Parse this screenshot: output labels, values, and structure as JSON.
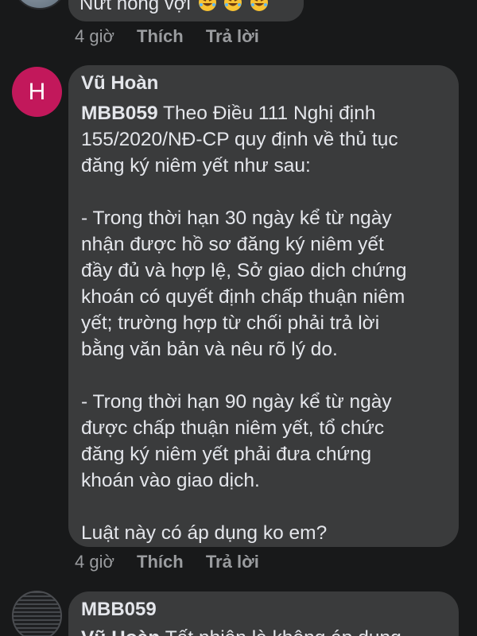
{
  "top_comment": {
    "text": "Nứt hông vợi",
    "emoji": [
      "rofl-emoji",
      "rofl-emoji",
      "rofl-emoji"
    ],
    "time": "4 giờ",
    "like_label": "Thích",
    "reply_label": "Trả lời"
  },
  "main_comment": {
    "avatar_letter": "H",
    "avatar_color": "#c2185b",
    "author": "Vũ Hoàn",
    "mention": "MBB059",
    "lines": [
      " Theo Điều 111 Nghị định",
      "155/2020/NĐ-CP quy định về thủ tục",
      "đăng ký niêm yết như sau:",
      "",
      "- Trong thời hạn 30 ngày kể từ ngày",
      "nhận được hồ sơ đăng ký niêm yết",
      "đầy đủ và hợp lệ, Sở giao dịch chứng",
      "khoán có quyết định chấp thuận niêm",
      "yết; trường hợp từ chối phải trả lời",
      "bằng văn bản và nêu rõ lý do.",
      "",
      "- Trong thời hạn 90 ngày kể từ ngày",
      "được chấp thuận niêm yết, tổ chức",
      "đăng ký niêm yết phải đưa chứng",
      "khoán vào giao dịch.",
      "",
      "Luật này có áp dụng ko em?"
    ],
    "time": "4 giờ",
    "like_label": "Thích",
    "reply_label": "Trả lời"
  },
  "reply_comment": {
    "author": "MBB059",
    "mention": "Vũ Hoàn",
    "text": " Tất nhiên là không áp dụng"
  },
  "colors": {
    "background": "#18191a",
    "bubble": "#3a3b3c",
    "text": "#e4e6eb",
    "meta": "#9a9c9f"
  }
}
